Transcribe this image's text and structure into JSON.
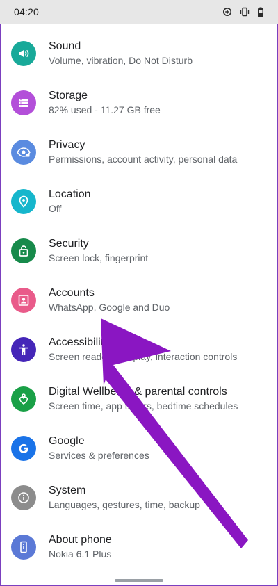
{
  "status_bar": {
    "time": "04:20",
    "icons": [
      "data-saver-icon",
      "vibrate-icon",
      "battery-icon"
    ]
  },
  "settings": [
    {
      "title": "Sound",
      "subtitle": "Volume, vibration, Do Not Disturb",
      "icon": "volume-icon",
      "color": "#18a999"
    },
    {
      "title": "Storage",
      "subtitle": "82% used - 11.27 GB free",
      "icon": "storage-icon",
      "color": "#b34fd9"
    },
    {
      "title": "Privacy",
      "subtitle": "Permissions, account activity, personal data",
      "icon": "privacy-eye-icon",
      "color": "#5a8be0"
    },
    {
      "title": "Location",
      "subtitle": "Off",
      "icon": "location-pin-icon",
      "color": "#16b6cc"
    },
    {
      "title": "Security",
      "subtitle": "Screen lock, fingerprint",
      "icon": "lock-icon",
      "color": "#178a4b"
    },
    {
      "title": "Accounts",
      "subtitle": "WhatsApp, Google and Duo",
      "icon": "account-icon",
      "color": "#e95b8a"
    },
    {
      "title": "Accessibility",
      "subtitle": "Screen readers, display, interaction controls",
      "icon": "accessibility-icon",
      "color": "#4526b8"
    },
    {
      "title": "Digital Wellbeing & parental controls",
      "subtitle": "Screen time, app timers, bedtime schedules",
      "icon": "wellbeing-icon",
      "color": "#1aa047"
    },
    {
      "title": "Google",
      "subtitle": "Services & preferences",
      "icon": "google-icon",
      "color": "#1a73e8"
    },
    {
      "title": "System",
      "subtitle": "Languages, gestures, time, backup",
      "icon": "info-icon",
      "color": "#8c8c8c"
    },
    {
      "title": "About phone",
      "subtitle": "Nokia 6.1 Plus",
      "icon": "phone-icon",
      "color": "#5b79d6"
    }
  ],
  "annotation": {
    "arrow_color": "#8a16c2"
  }
}
